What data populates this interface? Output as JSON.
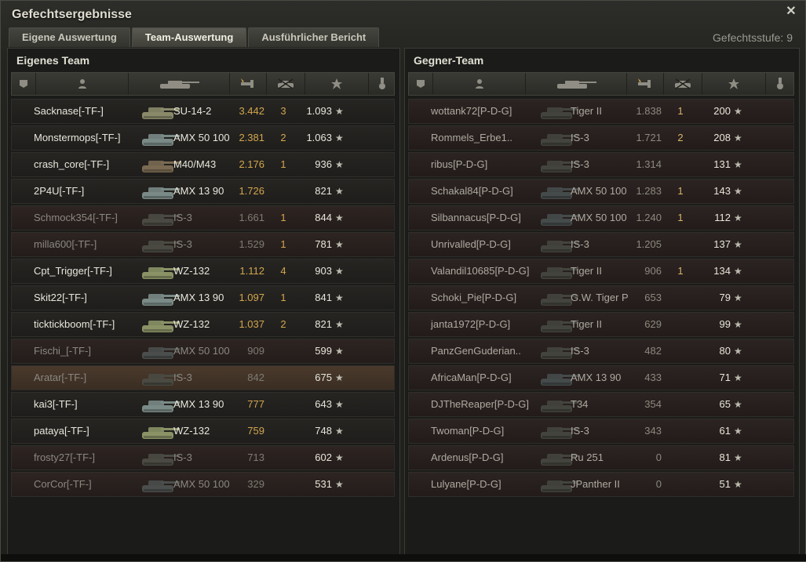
{
  "window": {
    "title": "Gefechtsergebnisse",
    "close_icon": "close-icon"
  },
  "tabs": [
    {
      "label": "Eigene Auswertung",
      "active": false
    },
    {
      "label": "Team-Auswertung",
      "active": true
    },
    {
      "label": "Ausführlicher Bericht",
      "active": false
    }
  ],
  "level_text": "Gefechtsstufe: 9",
  "colors": {
    "accent": "#d3a64e",
    "dead_row": "#2e2522",
    "self_row": "#4a3a2c"
  },
  "own_team": {
    "title": "Eigenes Team",
    "rows": [
      {
        "name": "Sacknase[-TF-]",
        "vehicle": "SU-14-2",
        "damage": "3.442",
        "kills": "3",
        "xp": "1.093",
        "dead": false,
        "tank_color": "#8a8a6a"
      },
      {
        "name": "Monstermops[-TF-]",
        "vehicle": "AMX 50 100",
        "damage": "2.381",
        "kills": "2",
        "xp": "1.063",
        "dead": false,
        "tank_color": "#7a8a86"
      },
      {
        "name": "crash_core[-TF-]",
        "vehicle": "M40/M43",
        "damage": "2.176",
        "kills": "1",
        "xp": "936",
        "dead": false,
        "tank_color": "#7a6a52"
      },
      {
        "name": "2P4U[-TF-]",
        "vehicle": "AMX 13 90",
        "damage": "1.726",
        "kills": "",
        "xp": "821",
        "dead": false,
        "tank_color": "#7a8a86"
      },
      {
        "name": "Schmock354[-TF-]",
        "vehicle": "IS-3",
        "damage": "1.661",
        "kills": "1",
        "xp": "844",
        "dead": true,
        "tank_color": "#4a4a42"
      },
      {
        "name": "milla600[-TF-]",
        "vehicle": "IS-3",
        "damage": "1.529",
        "kills": "1",
        "xp": "781",
        "dead": true,
        "tank_color": "#4a4a42"
      },
      {
        "name": "Cpt_Trigger[-TF-]",
        "vehicle": "WZ-132",
        "damage": "1.112",
        "kills": "4",
        "xp": "903",
        "dead": false,
        "tank_color": "#8a9266"
      },
      {
        "name": "Skit22[-TF-]",
        "vehicle": "AMX 13 90",
        "damage": "1.097",
        "kills": "1",
        "xp": "841",
        "dead": false,
        "tank_color": "#7a8a86"
      },
      {
        "name": "ticktickboom[-TF-]",
        "vehicle": "WZ-132",
        "damage": "1.037",
        "kills": "2",
        "xp": "821",
        "dead": false,
        "tank_color": "#8a9266"
      },
      {
        "name": "Fischi_[-TF-]",
        "vehicle": "AMX 50 100",
        "damage": "909",
        "kills": "",
        "xp": "599",
        "dead": true,
        "tank_color": "#4a4e4c"
      },
      {
        "name": "Aratar[-TF-]",
        "vehicle": "IS-3",
        "damage": "842",
        "kills": "",
        "xp": "675",
        "dead": true,
        "self": true,
        "tank_color": "#4a4a42"
      },
      {
        "name": "kai3[-TF-]",
        "vehicle": "AMX 13 90",
        "damage": "777",
        "kills": "",
        "xp": "643",
        "dead": false,
        "tank_color": "#7a8a86"
      },
      {
        "name": "pataya[-TF-]",
        "vehicle": "WZ-132",
        "damage": "759",
        "kills": "",
        "xp": "748",
        "dead": false,
        "tank_color": "#8a9266"
      },
      {
        "name": "frosty27[-TF-]",
        "vehicle": "IS-3",
        "damage": "713",
        "kills": "",
        "xp": "602",
        "dead": true,
        "tank_color": "#4a4a42"
      },
      {
        "name": "CorCor[-TF-]",
        "vehicle": "AMX 50 100",
        "damage": "329",
        "kills": "",
        "xp": "531",
        "dead": true,
        "tank_color": "#4a4e4c"
      }
    ]
  },
  "enemy_team": {
    "title": "Gegner-Team",
    "rows": [
      {
        "name": "wottank72[P-D-G]",
        "vehicle": "Tiger II",
        "damage": "1.838",
        "kills": "1",
        "xp": "200",
        "tank_color": "#44443e"
      },
      {
        "name": "Rommels_Erbe1..",
        "vehicle": "IS-3",
        "damage": "1.721",
        "kills": "2",
        "xp": "208",
        "tank_color": "#44443e"
      },
      {
        "name": "ribus[P-D-G]",
        "vehicle": "IS-3",
        "damage": "1.314",
        "kills": "",
        "xp": "131",
        "tank_color": "#44443e"
      },
      {
        "name": "Schakal84[P-D-G]",
        "vehicle": "AMX 50 100",
        "damage": "1.283",
        "kills": "1",
        "xp": "143",
        "tank_color": "#454a4a"
      },
      {
        "name": "Silbannacus[P-D-G]",
        "vehicle": "AMX 50 100",
        "damage": "1.240",
        "kills": "1",
        "xp": "112",
        "tank_color": "#454a4a"
      },
      {
        "name": "Unrivalled[P-D-G]",
        "vehicle": "IS-3",
        "damage": "1.205",
        "kills": "",
        "xp": "137",
        "tank_color": "#44443e"
      },
      {
        "name": "Valandil10685[P-D-G]",
        "vehicle": "Tiger II",
        "damage": "906",
        "kills": "1",
        "xp": "134",
        "tank_color": "#44443e"
      },
      {
        "name": "Schoki_Pie[P-D-G]",
        "vehicle": "G.W. Tiger P",
        "damage": "653",
        "kills": "",
        "xp": "79",
        "tank_color": "#44443e"
      },
      {
        "name": "janta1972[P-D-G]",
        "vehicle": "Tiger II",
        "damage": "629",
        "kills": "",
        "xp": "99",
        "tank_color": "#44443e"
      },
      {
        "name": "PanzGenGuderian..",
        "vehicle": "IS-3",
        "damage": "482",
        "kills": "",
        "xp": "80",
        "tank_color": "#44443e"
      },
      {
        "name": "AfricaMan[P-D-G]",
        "vehicle": "AMX 13 90",
        "damage": "433",
        "kills": "",
        "xp": "71",
        "tank_color": "#454a4a"
      },
      {
        "name": "DJTheReaper[P-D-G]",
        "vehicle": "T34",
        "damage": "354",
        "kills": "",
        "xp": "65",
        "tank_color": "#44443e"
      },
      {
        "name": "Twoman[P-D-G]",
        "vehicle": "IS-3",
        "damage": "343",
        "kills": "",
        "xp": "61",
        "tank_color": "#44443e"
      },
      {
        "name": "Ardenus[P-D-G]",
        "vehicle": "Ru 251",
        "damage": "0",
        "kills": "",
        "xp": "81",
        "tank_color": "#44443e"
      },
      {
        "name": "Lulyane[P-D-G]",
        "vehicle": "JPanther II",
        "damage": "0",
        "kills": "",
        "xp": "51",
        "tank_color": "#44443e"
      }
    ]
  },
  "column_icons": [
    "platoon-icon",
    "player-icon",
    "tank-icon",
    "damage-icon",
    "kills-icon",
    "xp-icon",
    "medal-icon"
  ],
  "star_glyph": "★"
}
